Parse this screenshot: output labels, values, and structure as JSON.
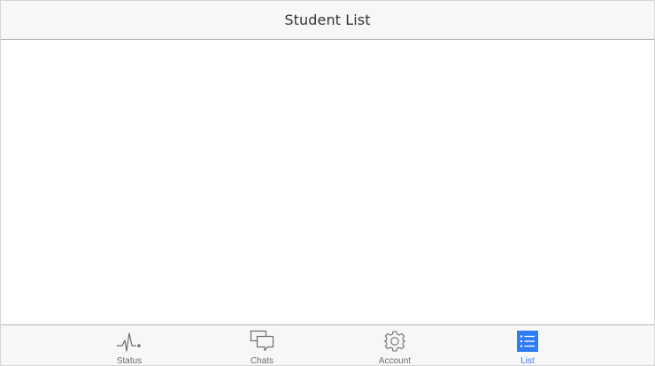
{
  "nav": {
    "title": "Student List"
  },
  "tabs": [
    {
      "label": "Status",
      "icon": "pulse-icon",
      "active": false
    },
    {
      "label": "Chats",
      "icon": "chat-bubbles-icon",
      "active": false
    },
    {
      "label": "Account",
      "icon": "gear-icon",
      "active": false
    },
    {
      "label": "List",
      "icon": "list-icon",
      "active": true
    }
  ],
  "colors": {
    "accent": "#2f7cf6",
    "inactive": "#6d6d6d",
    "bar_bg": "#f7f7f7"
  }
}
